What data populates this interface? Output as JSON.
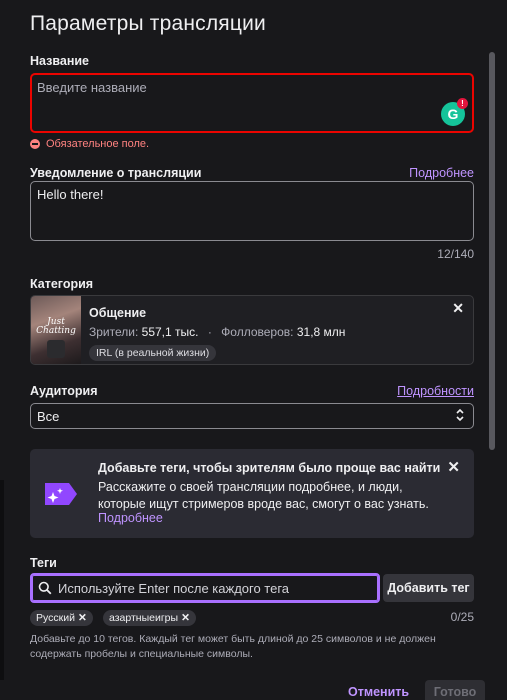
{
  "dialog": {
    "title": "Параметры трансляции"
  },
  "name_field": {
    "label": "Название",
    "placeholder": "Введите название",
    "error": "Обязательное поле.",
    "grammarly_letter": "G",
    "grammarly_badge": "!"
  },
  "notification_field": {
    "label": "Уведомление о трансляции",
    "link": "Подробнее",
    "value": "Hello there!",
    "counter": "12/140"
  },
  "category": {
    "label": "Категория",
    "boxart_text": "Just Chatting",
    "name": "Общение",
    "viewers_label": "Зрители:",
    "viewers_value": "557,1 тыс.",
    "separator": "·",
    "followers_label": "Фолловеров:",
    "followers_value": "31,8 млн",
    "tag": "IRL (в реальной жизни)",
    "remove": "✕"
  },
  "audience": {
    "label": "Аудитория",
    "link": "Подробности",
    "selected": "Все"
  },
  "promo": {
    "title": "Добавьте теги, чтобы зрителям было проще вас найти",
    "body": "Расскажите о своей трансляции подробнее, и люди, которые ищут стримеров вроде вас, смогут о вас узнать.",
    "link": "Подробнее",
    "close": "✕"
  },
  "tags": {
    "label": "Теги",
    "placeholder": "Используйте Enter после каждого тега",
    "add_button": "Добавить тег",
    "counter": "0/25",
    "chips": [
      {
        "label": "Русский",
        "remove": "✕"
      },
      {
        "label": "азартныеигры",
        "remove": "✕"
      }
    ],
    "hint": "Добавьте до 10 тегов. Каждый тег может быть длиной до 25 символов и не должен содержать пробелы и специальные символы."
  },
  "footer": {
    "cancel": "Отменить",
    "done": "Готово"
  },
  "colors": {
    "accent": "#bf94ff",
    "focus": "#a970ff",
    "error": "#eb0400",
    "background": "#18181b"
  }
}
